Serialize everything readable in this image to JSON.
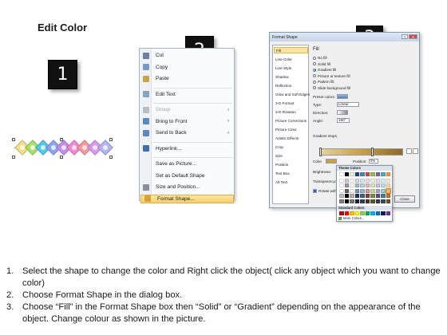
{
  "title": "Edit Color",
  "steps": {
    "one": "1",
    "two": "2",
    "three": "3"
  },
  "diamond_colors": [
    "#f1e08a",
    "#a8e06b",
    "#55c8e8",
    "#8ea5f2",
    "#c48ef0",
    "#f18ad3",
    "#f59b9b",
    "#d89af0",
    "#b4b4f5"
  ],
  "context_menu": {
    "items": [
      {
        "label": "Cut",
        "icon": "scissors-icon",
        "enabled": true
      },
      {
        "label": "Copy",
        "icon": "copy-icon",
        "enabled": true
      },
      {
        "label": "Paste",
        "icon": "paste-icon",
        "enabled": true
      },
      {
        "label": "Edit Text",
        "icon": "edit-text-icon",
        "enabled": true
      },
      {
        "label": "Group",
        "icon": "group-icon",
        "enabled": false,
        "submenu": true
      },
      {
        "label": "Bring to Front",
        "icon": "bring-to-front-icon",
        "enabled": true,
        "submenu": true
      },
      {
        "label": "Send to Back",
        "icon": "send-to-back-icon",
        "enabled": true,
        "submenu": true
      },
      {
        "label": "Hyperlink...",
        "icon": "hyperlink-icon",
        "enabled": true
      },
      {
        "label": "Save as Picture...",
        "icon": "",
        "enabled": true
      },
      {
        "label": "Set as Default Shape",
        "icon": "",
        "enabled": true
      },
      {
        "label": "Size and Position...",
        "icon": "size-position-icon",
        "enabled": true
      },
      {
        "label": "Format Shape...",
        "icon": "format-shape-icon",
        "enabled": true,
        "highlighted": true
      }
    ]
  },
  "format_dialog": {
    "title": "Format Shape",
    "nav": [
      "Fill",
      "Line Color",
      "Line Style",
      "Shadow",
      "Reflection",
      "Glow and Soft Edges",
      "3-D Format",
      "3-D Rotation",
      "Picture Corrections",
      "Picture Color",
      "Artistic Effects",
      "Crop",
      "Size",
      "Position",
      "Text Box",
      "Alt Text"
    ],
    "pane_title": "Fill",
    "fill_options": [
      "No fill",
      "Solid fill",
      "Gradient fill",
      "Picture or texture fill",
      "Pattern fill",
      "Slide background fill"
    ],
    "preset_colors_label": "Preset colors:",
    "type_label": "Type:",
    "type_value": "Linear",
    "direction_label": "Direction:",
    "angle_label": "Angle:",
    "angle_value": "180°",
    "gradient_stops_label": "Gradient stops",
    "color_label": "Color",
    "position_label": "Position:",
    "position_value": "0%",
    "brightness_label": "Brightness:",
    "transparency_label": "Transparency:",
    "rotate_label": "Rotate with shape",
    "close_label": "Close"
  },
  "palette": {
    "theme_label": "Theme Colors",
    "standard_label": "Standard Colors",
    "more_label": "More Colors...",
    "theme_top": [
      "#ffffff",
      "#000000",
      "#eeece1",
      "#1f497d",
      "#4f81bd",
      "#c0504d",
      "#9bbb59",
      "#8064a2",
      "#4bacc6",
      "#f79646"
    ],
    "standard": [
      "#c00000",
      "#ff0000",
      "#ffc000",
      "#ffff00",
      "#92d050",
      "#00b050",
      "#00b0f0",
      "#0070c0",
      "#002060",
      "#7030a0"
    ]
  },
  "instructions": [
    {
      "num": "1.",
      "text": "Select the shape to change the color and Right click the object( click any object which you want to change color)"
    },
    {
      "num": "2.",
      "text": "Choose Format Shape in the dialog box."
    },
    {
      "num": "3.",
      "text": "Choose “Fill” in the Format Shape box then “Solid” or “Gradient” depending on the appearance of the object. Change colour as shown in the picture."
    }
  ]
}
